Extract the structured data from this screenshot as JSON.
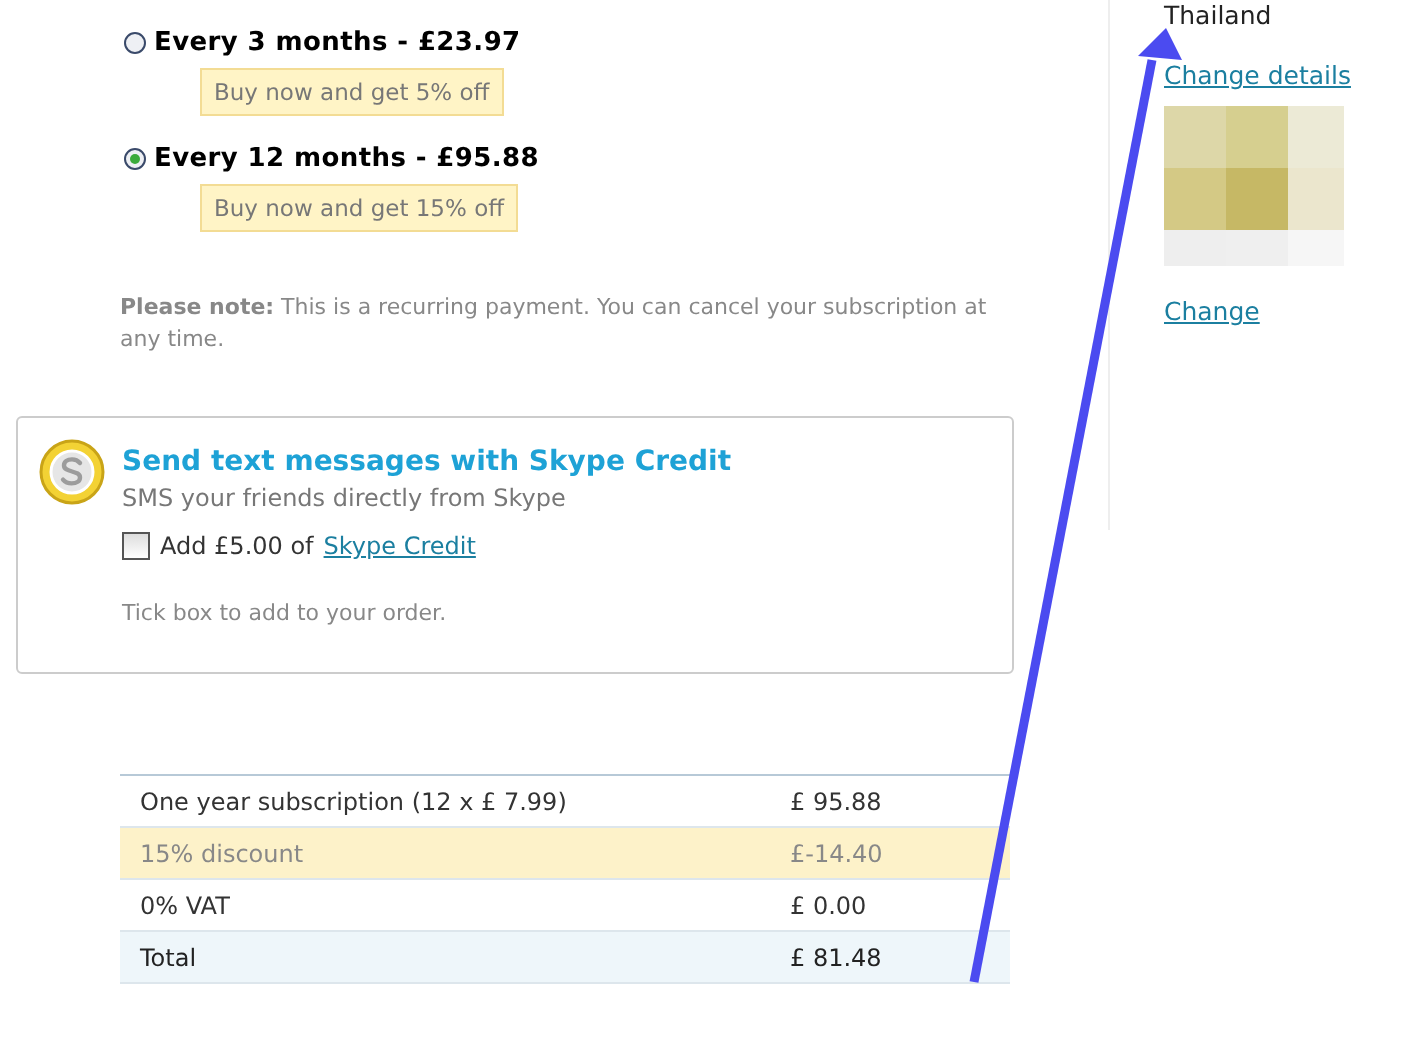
{
  "plans": [
    {
      "label": "Every 3 months - £23.97",
      "selected": false,
      "offer": "Buy now and get 5% off"
    },
    {
      "label": "Every 12 months - £95.88",
      "selected": true,
      "offer": "Buy now and get 15% off"
    }
  ],
  "note": "**Please note:** This is a recurring payment. You can cancel your subscription at any time.",
  "credit_card": {
    "title": "Send text messages with Skype Credit",
    "subtitle": "SMS your friends directly from Skype",
    "checkbox_label": "Add £5.00 of",
    "link": "Skype Credit",
    "checked": false,
    "hint": "Tick box to add to your order."
  },
  "summary": [
    {
      "kind": "item",
      "label": "One year subscription (12 x £ 7.99)",
      "amount": "£ 95.88"
    },
    {
      "kind": "discount",
      "label": "15% discount",
      "amount": "£-14.40"
    },
    {
      "kind": "item",
      "label": "0% VAT",
      "amount": "£ 0.00"
    },
    {
      "kind": "total",
      "label": "Total",
      "amount": "£ 81.48"
    }
  ],
  "sidebar": {
    "country": "Thailand",
    "change_details": "Change details",
    "change": "Change"
  }
}
